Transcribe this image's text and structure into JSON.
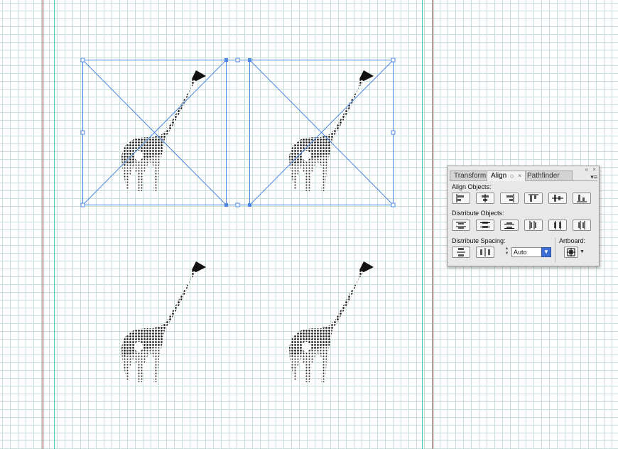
{
  "colors": {
    "grid": "#c8dede",
    "margin_line": "#7a1f1f",
    "guide_line": "#3ec8c0",
    "selection": "#4a86e8",
    "giraffe": "#1a1a1a"
  },
  "canvas": {
    "giraffes": [
      {
        "name": "giraffe-top-left",
        "selected": true
      },
      {
        "name": "giraffe-top-right",
        "selected": true
      },
      {
        "name": "giraffe-bottom-left",
        "selected": false
      },
      {
        "name": "giraffe-bottom-right",
        "selected": false
      }
    ]
  },
  "panel": {
    "tabs": [
      {
        "label": "Transform",
        "active": false
      },
      {
        "label": "Align",
        "active": true,
        "chevron": "◇"
      },
      {
        "label": "Pathfinder",
        "active": false
      }
    ],
    "close_glyph": "×",
    "collapse_glyph": "«",
    "menu_glyph": "▾≡",
    "align_objects_label": "Align Objects:",
    "align_buttons": [
      "align-left-icon",
      "align-horizontal-center-icon",
      "align-right-icon",
      "align-top-icon",
      "align-vertical-center-icon",
      "align-bottom-icon"
    ],
    "distribute_objects_label": "Distribute Objects:",
    "distribute_buttons": [
      "distribute-top-icon",
      "distribute-vertical-center-icon",
      "distribute-bottom-icon",
      "distribute-left-icon",
      "distribute-horizontal-center-icon",
      "distribute-right-icon"
    ],
    "distribute_spacing_label": "Distribute Spacing:",
    "spacing_buttons": [
      "vertical-distribute-space-icon",
      "horizontal-distribute-space-icon"
    ],
    "spacing_value": "Auto",
    "dropdown_glyph": "▼",
    "artboard_label": "Artboard:",
    "artboard_icon": "align-to-artboard-icon",
    "artboard_drop_glyph": "▼"
  }
}
